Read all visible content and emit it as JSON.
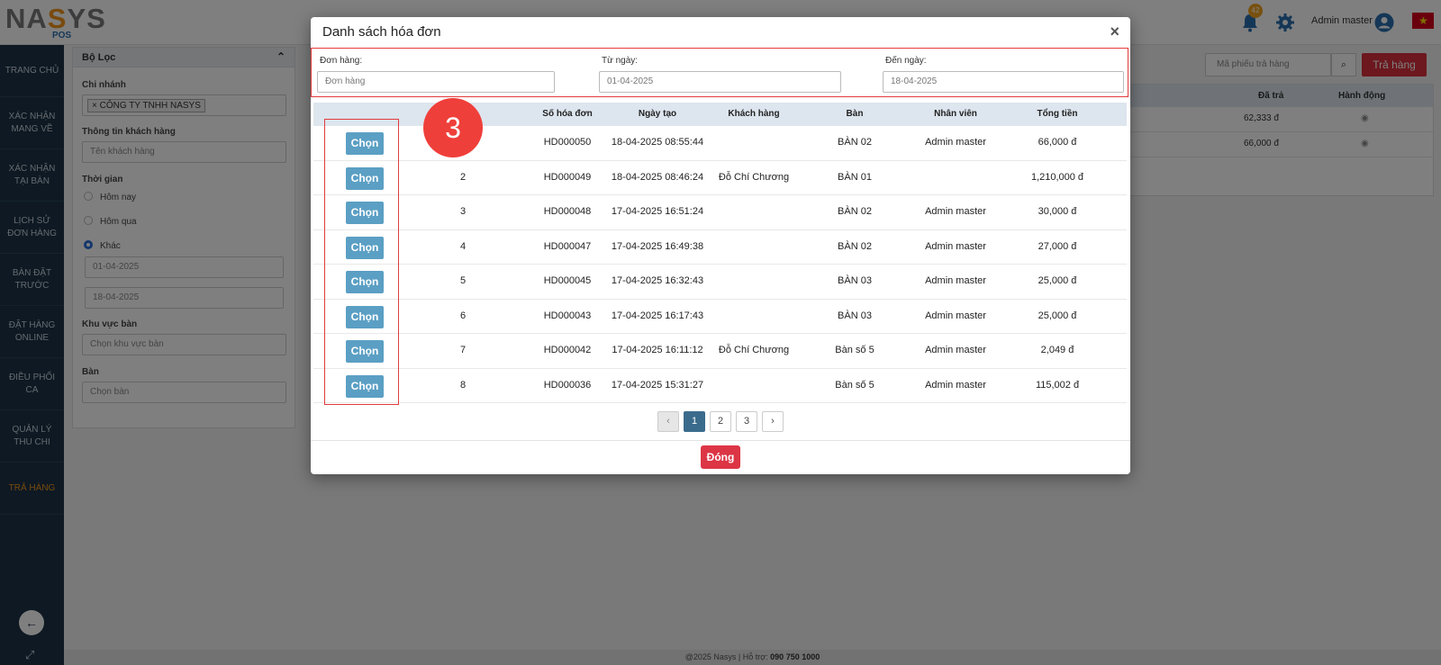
{
  "app": {
    "logo_text": "NASYS",
    "logo_sub": "POS",
    "notification_count": "42",
    "user_name": "Admin master"
  },
  "sidebar": {
    "items": [
      {
        "label": "TRANG CHỦ"
      },
      {
        "label": "XÁC NHẬN MANG VỀ"
      },
      {
        "label": "XÁC NHẬN TẠI BÀN"
      },
      {
        "label": "LỊCH SỬ ĐƠN HÀNG"
      },
      {
        "label": "BÀN ĐẶT TRƯỚC"
      },
      {
        "label": "ĐẶT HÀNG ONLINE"
      },
      {
        "label": "ĐIỀU PHỐI CA"
      },
      {
        "label": "QUẢN LÝ THU CHI"
      },
      {
        "label": "TRẢ HÀNG"
      }
    ]
  },
  "filter": {
    "title": "Bộ Lọc",
    "branch_label": "Chi nhánh",
    "branch_value": "CÔNG TY TNHH NASYS",
    "customer_label": "Thông tin khách hàng",
    "customer_placeholder": "Tên khách hàng",
    "time_label": "Thời gian",
    "time_today": "Hôm nay",
    "time_yesterday": "Hôm qua",
    "time_other": "Khác",
    "date_from": "01-04-2025",
    "date_to": "18-04-2025",
    "area_label": "Khu vực bàn",
    "area_placeholder": "Chọn khu vực bàn",
    "table_label": "Bàn",
    "table_placeholder": "Chọn bàn"
  },
  "background_page": {
    "search_placeholder": "Mã phiếu trả hàng",
    "return_button": "Trả hàng",
    "col_paid": "Đã trả",
    "col_action": "Hành động",
    "rows": [
      {
        "paid": "62,333 đ"
      },
      {
        "paid": "66,000 đ"
      }
    ]
  },
  "footer": {
    "text": "@2025 Nasys | Hỗ trợ: ",
    "phone": "090 750 1000"
  },
  "modal": {
    "title": "Danh sách hóa đơn",
    "order_label": "Đơn hàng:",
    "order_placeholder": "Đơn hàng",
    "from_label": "Từ ngày:",
    "from_value": "01-04-2025",
    "to_label": "Đến ngày:",
    "to_value": "18-04-2025",
    "columns": {
      "invoice_no": "Số hóa đơn",
      "created": "Ngày tạo",
      "customer": "Khách hàng",
      "table": "Bàn",
      "staff": "Nhân viên",
      "total": "Tổng tiền"
    },
    "select_label": "Chọn",
    "rows": [
      {
        "idx": "",
        "invoice": "HD000050",
        "created": "18-04-2025 08:55:44",
        "customer": "",
        "table": "BÀN 02",
        "staff": "Admin master",
        "total": "66,000 đ"
      },
      {
        "idx": "2",
        "invoice": "HD000049",
        "created": "18-04-2025 08:46:24",
        "customer": "Đỗ Chí Chương",
        "table": "BÀN 01",
        "staff": "",
        "total": "1,210,000 đ"
      },
      {
        "idx": "3",
        "invoice": "HD000048",
        "created": "17-04-2025 16:51:24",
        "customer": "",
        "table": "BÀN 02",
        "staff": "Admin master",
        "total": "30,000 đ"
      },
      {
        "idx": "4",
        "invoice": "HD000047",
        "created": "17-04-2025 16:49:38",
        "customer": "",
        "table": "BÀN 02",
        "staff": "Admin master",
        "total": "27,000 đ"
      },
      {
        "idx": "5",
        "invoice": "HD000045",
        "created": "17-04-2025 16:32:43",
        "customer": "",
        "table": "BÀN 03",
        "staff": "Admin master",
        "total": "25,000 đ"
      },
      {
        "idx": "6",
        "invoice": "HD000043",
        "created": "17-04-2025 16:17:43",
        "customer": "",
        "table": "BÀN 03",
        "staff": "Admin master",
        "total": "25,000 đ"
      },
      {
        "idx": "7",
        "invoice": "HD000042",
        "created": "17-04-2025 16:11:12",
        "customer": "Đỗ Chí Chương",
        "table": "Bàn số 5",
        "staff": "Admin master",
        "total": "2,049 đ"
      },
      {
        "idx": "8",
        "invoice": "HD000036",
        "created": "17-04-2025 15:31:27",
        "customer": "",
        "table": "Bàn số 5",
        "staff": "Admin master",
        "total": "115,002 đ"
      }
    ],
    "pagination": {
      "prev": "‹",
      "pages": [
        "1",
        "2",
        "3"
      ],
      "next": "›",
      "active": "1"
    },
    "close_button": "Đóng",
    "step_marker": "3"
  },
  "colors": {
    "primary_dark": "#1d3347",
    "accent_orange": "#f2941a",
    "danger": "#dc3545",
    "select_button": "#5b9fc4",
    "highlight_border": "#e23b3b"
  }
}
